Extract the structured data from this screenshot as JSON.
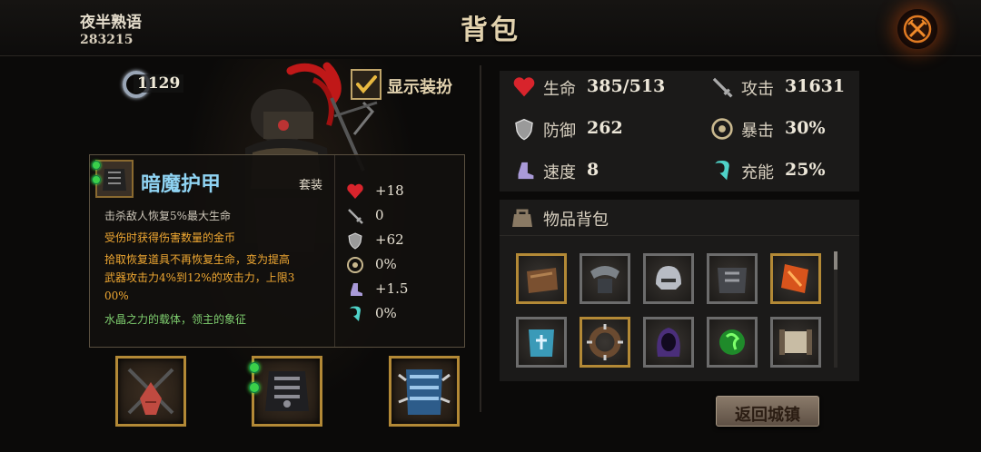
{
  "header": {
    "player_name": "夜半熟语",
    "player_id": "283215",
    "title": "背包",
    "close_icon": "crossed-swords-close-icon"
  },
  "hero": {
    "power_value": "1129",
    "show_outfit_label": "显示装扮",
    "show_outfit_checked": true
  },
  "item_detail": {
    "name": "暗魔护甲",
    "set_label": "套装",
    "descriptions": [
      {
        "text": "击杀敌人恢复5%最大生命",
        "style": "white"
      },
      {
        "text": "受伤时获得伤害数量的金币",
        "style": "orange"
      },
      {
        "text": "拾取恢复道具不再恢复生命，变为提高",
        "style": "orange"
      },
      {
        "text": "武器攻击力4%到12%的攻击力，上限3",
        "style": "orange"
      },
      {
        "text": "00%",
        "style": "orange"
      },
      {
        "text": "水晶之力的载体，领主的象征",
        "style": "green"
      }
    ],
    "stats": [
      {
        "icon": "heart-icon",
        "value": "+18"
      },
      {
        "icon": "sword-icon",
        "value": "0"
      },
      {
        "icon": "shield-icon",
        "value": "+62"
      },
      {
        "icon": "crit-icon",
        "value": "0%"
      },
      {
        "icon": "boot-icon",
        "value": "+1.5"
      },
      {
        "icon": "energy-icon",
        "value": "0%"
      }
    ]
  },
  "equipment_slots": [
    {
      "name": "weapon",
      "icon": "crossed-weapon-icon"
    },
    {
      "name": "armor",
      "icon": "dark-armor-icon"
    },
    {
      "name": "accessory",
      "icon": "blue-armor-icon"
    }
  ],
  "stats": {
    "hp_label": "生命",
    "hp_value": "385/513",
    "attack_label": "攻击",
    "attack_value": "31631",
    "defense_label": "防御",
    "defense_value": "262",
    "crit_label": "暴击",
    "crit_value": "30%",
    "speed_label": "速度",
    "speed_value": "8",
    "energy_label": "充能",
    "energy_value": "25%"
  },
  "inventory": {
    "title": "物品背包",
    "items": [
      {
        "icon": "brown-pouch-icon"
      },
      {
        "icon": "steel-shoulder-icon"
      },
      {
        "icon": "steel-helm-icon"
      },
      {
        "icon": "dark-chestplate-icon"
      },
      {
        "icon": "fire-scroll-icon"
      },
      {
        "icon": "blue-armor-icon"
      },
      {
        "icon": "spiked-collar-icon"
      },
      {
        "icon": "purple-hood-icon"
      },
      {
        "icon": "green-orb-icon"
      },
      {
        "icon": "paper-scroll-icon"
      }
    ]
  },
  "return_button_label": "返回城镇",
  "colors": {
    "accent_gold": "#b38936",
    "item_name_blue": "#8fd3f2",
    "desc_orange": "#f0a832",
    "desc_green": "#7fcf6f"
  }
}
